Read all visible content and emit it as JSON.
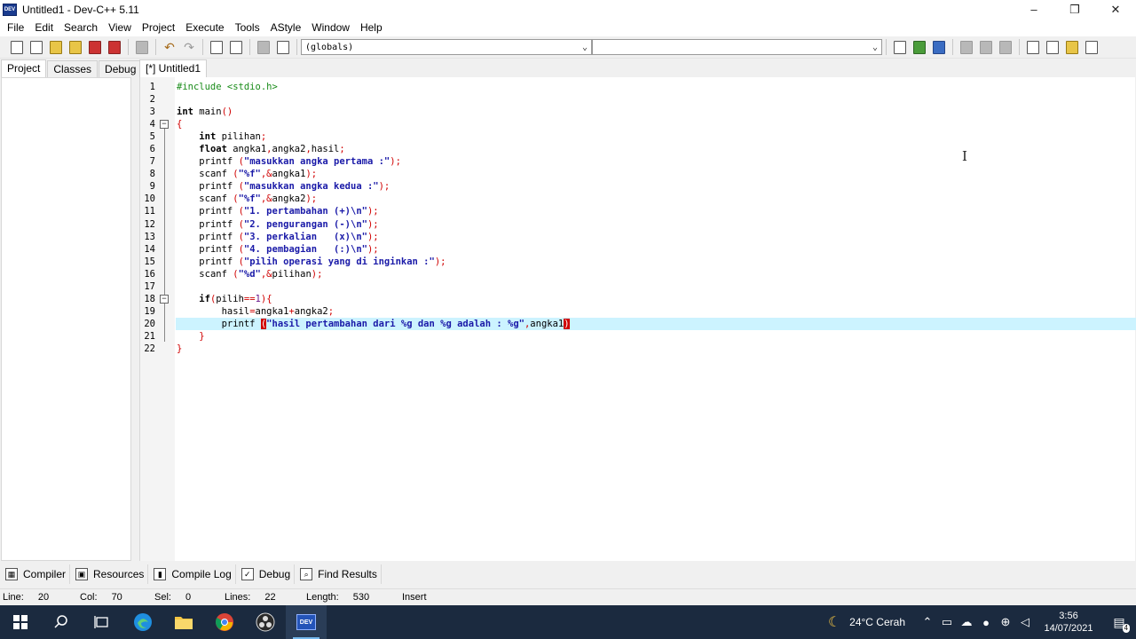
{
  "window": {
    "title": "Untitled1 - Dev-C++ 5.11",
    "app_icon_text": "DEV"
  },
  "window_controls": {
    "minimize": "–",
    "restore": "❐",
    "close": "✕"
  },
  "menu": [
    "File",
    "Edit",
    "Search",
    "View",
    "Project",
    "Execute",
    "Tools",
    "AStyle",
    "Window",
    "Help"
  ],
  "toolbar": {
    "globals_combo": "(globals)",
    "second_combo": ""
  },
  "left_tabs": [
    "Project",
    "Classes",
    "Debug"
  ],
  "editor_tab": "[*] Untitled1",
  "code_lines": [
    {
      "n": "1"
    },
    {
      "n": "2"
    },
    {
      "n": "3"
    },
    {
      "n": "4"
    },
    {
      "n": "5"
    },
    {
      "n": "6"
    },
    {
      "n": "7"
    },
    {
      "n": "8"
    },
    {
      "n": "9"
    },
    {
      "n": "10"
    },
    {
      "n": "11"
    },
    {
      "n": "12"
    },
    {
      "n": "13"
    },
    {
      "n": "14"
    },
    {
      "n": "15"
    },
    {
      "n": "16"
    },
    {
      "n": "17"
    },
    {
      "n": "18"
    },
    {
      "n": "19"
    },
    {
      "n": "20"
    },
    {
      "n": "21"
    },
    {
      "n": "22"
    }
  ],
  "code": {
    "l1_pp": "#include <stdio.h>",
    "l3_kw": "int",
    "l3_rest": " main",
    "l3_parens": "()",
    "l4": "{",
    "l5_kw": "int",
    "l5_rest": " pilihan",
    "l5_semi": ";",
    "l6_kw": "float",
    "l6_a": " angka1",
    "l6_c1": ",",
    "l6_b": "angka2",
    "l6_c2": ",",
    "l6_c": "hasil",
    "l6_semi": ";",
    "l7_fn": "printf ",
    "l7_open": "(",
    "l7_str": "\"masukkan angka pertama :\"",
    "l7_close": ");",
    "l8_fn": "scanf ",
    "l8_open": "(",
    "l8_str": "\"%f\"",
    "l8_comma": ",&",
    "l8_var": "angka1",
    "l8_close": ");",
    "l9_fn": "printf ",
    "l9_open": "(",
    "l9_str": "\"masukkan angka kedua :\"",
    "l9_close": ");",
    "l10_fn": "scanf ",
    "l10_open": "(",
    "l10_str": "\"%f\"",
    "l10_comma": ",&",
    "l10_var": "angka2",
    "l10_close": ");",
    "l11_fn": "printf ",
    "l11_open": "(",
    "l11_str": "\"1. pertambahan (+)\\n\"",
    "l11_close": ");",
    "l12_fn": "printf ",
    "l12_open": "(",
    "l12_str": "\"2. pengurangan (-)\\n\"",
    "l12_close": ");",
    "l13_fn": "printf ",
    "l13_open": "(",
    "l13_str": "\"3. perkalian   (x)\\n\"",
    "l13_close": ");",
    "l14_fn": "printf ",
    "l14_open": "(",
    "l14_str": "\"4. pembagian   (:)\\n\"",
    "l14_close": ");",
    "l15_fn": "printf ",
    "l15_open": "(",
    "l15_str": "\"pilih operasi yang di inginkan :\"",
    "l15_close": ");",
    "l16_fn": "scanf ",
    "l16_open": "(",
    "l16_str": "\"%d\"",
    "l16_comma": ",&",
    "l16_var": "pilihan",
    "l16_close": ");",
    "l18_kw": "if",
    "l18_open": "(",
    "l18_var": "pilih",
    "l18_op": "==",
    "l18_num": "1",
    "l18_close": "){",
    "l19_a": "hasil",
    "l19_op1": "=",
    "l19_b": "angka1",
    "l19_op2": "+",
    "l19_c": "angka2",
    "l19_semi": ";",
    "l20_fn": "printf ",
    "l20_open": "(",
    "l20_str": "\"hasil pertambahan dari %g dan %g adalah : %g\"",
    "l20_comma": ",",
    "l20_var": "angka1",
    "l20_close": ")",
    "l21": "}",
    "l22": "}"
  },
  "bottom_tabs": [
    "Compiler",
    "Resources",
    "Compile Log",
    "Debug",
    "Find Results"
  ],
  "status": {
    "line_label": "Line:",
    "line_val": "20",
    "col_label": "Col:",
    "col_val": "70",
    "sel_label": "Sel:",
    "sel_val": "0",
    "lines_label": "Lines:",
    "lines_val": "22",
    "length_label": "Length:",
    "length_val": "530",
    "mode": "Insert"
  },
  "taskbar": {
    "weather": "24°C  Cerah",
    "time": "3:56",
    "date": "14/07/2021",
    "notification_count": "4",
    "active_app_label": "DEV"
  }
}
